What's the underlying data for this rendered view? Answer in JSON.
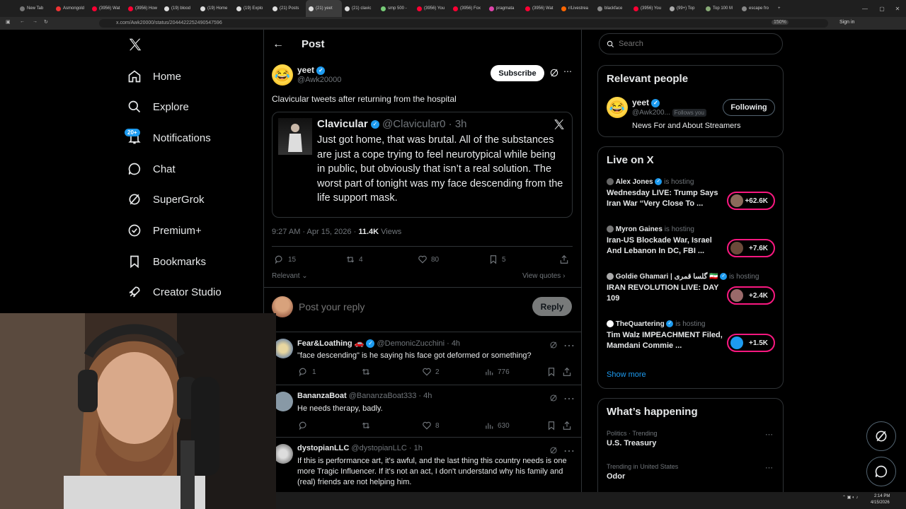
{
  "browser": {
    "tabs": [
      "New Tab",
      "Asmongold",
      "(3956) Wat",
      "(3956) How",
      "(19) blood",
      "(19) Home",
      "(19) Explo",
      "(21) Posts",
      "(21) yeet",
      "(21) clavic",
      "smp 500 -",
      "(3956) You",
      "(3956) Fox",
      "pragmata",
      "(3956) Wat",
      "r/Livestrea",
      "blackface",
      "(3956) You",
      "(99+) Top",
      "Top 100 M",
      "escape fro"
    ],
    "url": "x.com/Awk20000/status/2044422252490547596",
    "zoom": "150%",
    "sign_in": "Sign in"
  },
  "nav": {
    "home": "Home",
    "explore": "Explore",
    "notifications": "Notifications",
    "notifications_badge": "20+",
    "chat": "Chat",
    "supergrok": "SuperGrok",
    "premium": "Premium+",
    "bookmarks": "Bookmarks",
    "creator_studio": "Creator Studio"
  },
  "header": {
    "title": "Post"
  },
  "post": {
    "author_name": "yeet",
    "author_handle": "@Awk20000",
    "subscribe": "Subscribe",
    "text": "Clavicular tweets after returning from the hospital",
    "quote": {
      "name": "Clavicular",
      "handle": "@Clavicular0",
      "time": "· 3h",
      "text": "Just got home, that was brutal. All of the substances are just a cope trying to feel neurotypical while being in public, but obviously that isn’t a real solution. The worst part of tonight was my face descending from the life support mask."
    },
    "timestamp": "9:27 AM · Apr 15, 2026 ·",
    "views": "11.4K",
    "views_label": "Views",
    "replies": "15",
    "reposts": "4",
    "likes": "80",
    "bookmarks": "5",
    "sort": "Relevant",
    "view_quotes": "View quotes"
  },
  "compose": {
    "placeholder": "Post your reply",
    "button": "Reply"
  },
  "replies": [
    {
      "name": "Fear&Loathing",
      "handle": "@DemonicZucchini",
      "time": "· 4h",
      "text": "\"face descending\" is he saying his face got deformed or something?",
      "replies": "1",
      "reposts": "",
      "likes": "2",
      "views": "776"
    },
    {
      "name": "BananzaBoat",
      "handle": "@BananzaBoat333",
      "time": "· 4h",
      "text": "He needs therapy, badly.",
      "replies": "",
      "reposts": "",
      "likes": "8",
      "views": "630"
    },
    {
      "name": "dystopianLLC",
      "handle": "@dystopianLLC",
      "time": "· 1h",
      "text": "If this is performance art, it's awful, and the last thing this country needs is one more Tragic Influencer. If it's not an act, I don't understand why his family and (real) friends are not helping him."
    }
  ],
  "search": {
    "placeholder": "Search"
  },
  "relevant": {
    "title": "Relevant people",
    "name": "yeet",
    "handle": "@Awk200...",
    "follows_you": "Follows you",
    "button": "Following",
    "bio": "News For and About Streamers"
  },
  "live": {
    "title": "Live on X",
    "hosting": "is hosting",
    "items": [
      {
        "host": "Alex Jones",
        "title": "Wednesday LIVE: Trump Says Iran War “Very Close To ...",
        "count": "+62.6K"
      },
      {
        "host": "Myron Gaines",
        "title": "Iran-US Blockade War, Israel And Lebanon In DC, FBI ...",
        "count": "+7.6K"
      },
      {
        "host": "Goldie Ghamari | گلسا قمری 🇮🇷",
        "title": "IRAN REVOLUTION LIVE: DAY 109",
        "count": "+2.4K"
      },
      {
        "host": "TheQuartering",
        "title": "Tim Walz IMPEACHMENT Filed, Mamdani Commie ...",
        "count": "+1.5K"
      }
    ],
    "show_more": "Show more"
  },
  "trending": {
    "title": "What’s happening",
    "items": [
      {
        "context": "Politics · Trending",
        "topic": "U.S. Treasury"
      },
      {
        "context": "Trending in United States",
        "topic": "Odor"
      }
    ]
  },
  "taskbar": {
    "time": "2:14 PM",
    "date": "4/15/2026"
  },
  "colors": {
    "accent": "#1d9bf0",
    "live": "#f91880",
    "bg": "#000000"
  }
}
